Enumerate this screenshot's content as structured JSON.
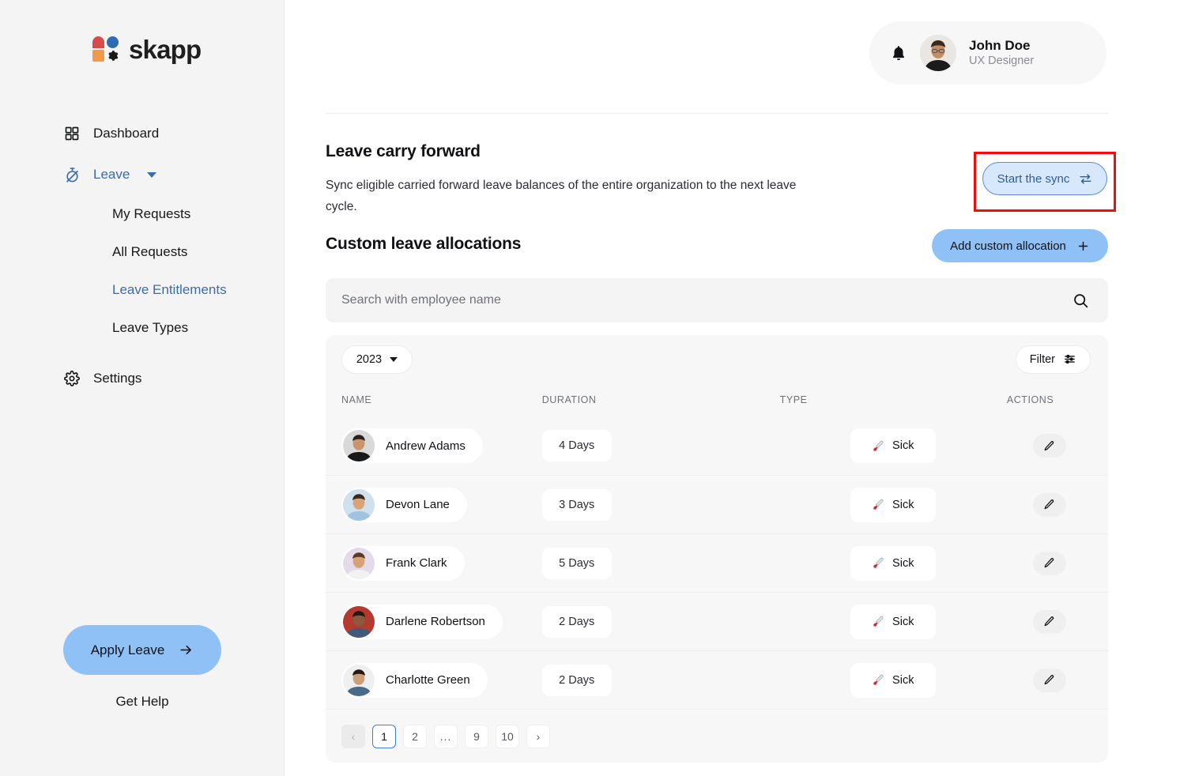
{
  "brand": {
    "name": "skapp",
    "logo_icon": "skapp-logo-icon"
  },
  "sidebar": {
    "items": [
      {
        "label": "Dashboard",
        "icon": "grid-dashboard-icon"
      },
      {
        "label": "Leave",
        "icon": "stopwatch-off-icon",
        "caret": "chevron-down-icon"
      },
      {
        "label": "Settings",
        "icon": "gear-icon"
      }
    ],
    "subitems": [
      {
        "label": "My Requests"
      },
      {
        "label": "All Requests"
      },
      {
        "label": "Leave Entitlements"
      },
      {
        "label": "Leave Types"
      }
    ],
    "apply_leave": {
      "label": "Apply Leave",
      "icon": "arrow-right-icon"
    },
    "get_help": "Get Help"
  },
  "header": {
    "notification_icon": "bell-icon",
    "user": {
      "name": "John Doe",
      "role": "UX Designer",
      "avatar": "user-avatar"
    }
  },
  "carry_forward": {
    "title": "Leave carry forward",
    "description": "Sync eligible carried forward leave balances of the entire organization to the next leave cycle.",
    "sync_button": {
      "label": "Start the sync",
      "icon": "sync-arrows-icon"
    }
  },
  "allocations": {
    "title": "Custom leave allocations",
    "add_button": {
      "label": "Add custom allocation",
      "icon": "plus-icon"
    },
    "search": {
      "placeholder": "Search with employee name",
      "value": "",
      "icon": "search-icon"
    },
    "year_filter": {
      "value": "2023",
      "icon": "chevron-down-icon"
    },
    "filter_button": {
      "label": "Filter",
      "icon": "sliders-icon"
    },
    "columns": [
      "NAME",
      "DURATION",
      "TYPE",
      "ACTIONS"
    ],
    "rows": [
      {
        "name": "Andrew Adams",
        "duration": "4 Days",
        "type": "Sick",
        "type_icon": "thermometer-icon",
        "action_icon": "pencil-icon"
      },
      {
        "name": "Devon Lane",
        "duration": "3 Days",
        "type": "Sick",
        "type_icon": "thermometer-icon",
        "action_icon": "pencil-icon"
      },
      {
        "name": "Frank Clark",
        "duration": "5 Days",
        "type": "Sick",
        "type_icon": "thermometer-icon",
        "action_icon": "pencil-icon"
      },
      {
        "name": "Darlene Robertson",
        "duration": "2 Days",
        "type": "Sick",
        "type_icon": "thermometer-icon",
        "action_icon": "pencil-icon"
      },
      {
        "name": "Charlotte Green",
        "duration": "2 Days",
        "type": "Sick",
        "type_icon": "thermometer-icon",
        "action_icon": "pencil-icon"
      }
    ],
    "pagination": {
      "prev": "‹",
      "next": "›",
      "pages": [
        "1",
        "2",
        "...",
        "9",
        "10"
      ],
      "current": "1"
    }
  },
  "colors": {
    "accent_blue": "#8fc1f7",
    "link_blue": "#3a6cb0",
    "sync_fill": "#d7e8fc",
    "sync_border": "#5b8ed6",
    "highlight_red": "#f60a0a",
    "sidebar_bg": "#f4f4f4",
    "card_bg": "#f7f7f7"
  }
}
